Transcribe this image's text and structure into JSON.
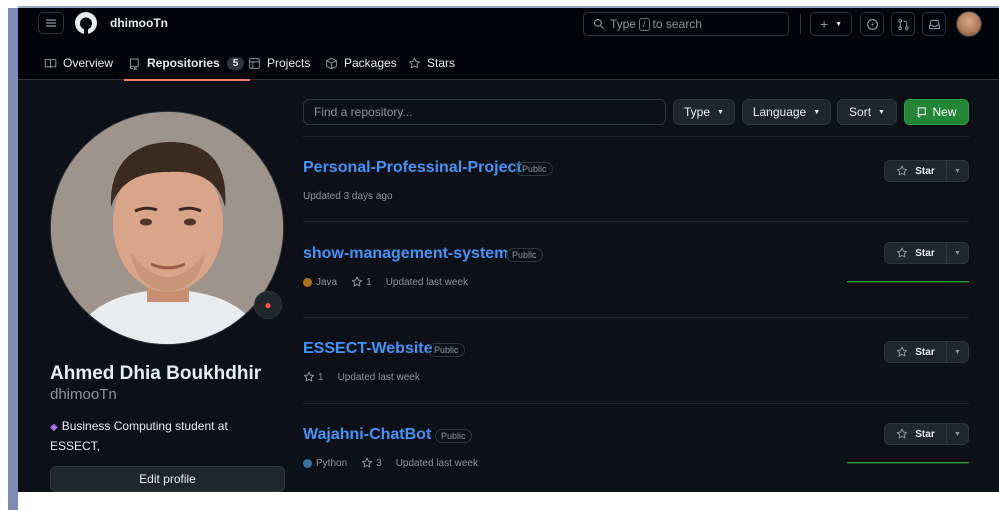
{
  "header": {
    "username": "dhimooTn",
    "search": {
      "prefix": "Type",
      "key": "/",
      "suffix": "to search"
    },
    "create_label": "+"
  },
  "tabs": [
    {
      "label": "Overview"
    },
    {
      "label": "Repositories",
      "count": "5"
    },
    {
      "label": "Projects"
    },
    {
      "label": "Packages"
    },
    {
      "label": "Stars"
    }
  ],
  "profile": {
    "name": "Ahmed Dhia Boukhdhir",
    "login": "dhimooTn",
    "bio": "Business Computing student at ESSECT,",
    "edit_label": "Edit profile"
  },
  "filters": {
    "find_placeholder": "Find a repository...",
    "type_label": "Type",
    "language_label": "Language",
    "sort_label": "Sort",
    "new_label": "New"
  },
  "repos": [
    {
      "name": "Personal-Professinal-Project",
      "visibility": "Public",
      "updated": "Updated 3 days ago"
    },
    {
      "name": "show-management-system",
      "visibility": "Public",
      "language": "Java",
      "language_color": "#b07219",
      "stars": "1",
      "updated": "Updated last week"
    },
    {
      "name": "ESSECT-Website",
      "visibility": "Public",
      "stars": "1",
      "updated": "Updated last week"
    },
    {
      "name": "Wajahni-ChatBot",
      "visibility": "Public",
      "language": "Python",
      "language_color": "#3572A5",
      "stars": "3",
      "updated": "Updated last week"
    }
  ],
  "star_label": "Star",
  "colors": {
    "accent_link": "#4493f8",
    "new_button": "#238636",
    "tab_underline": "#f78166",
    "background": "#0d1117"
  }
}
